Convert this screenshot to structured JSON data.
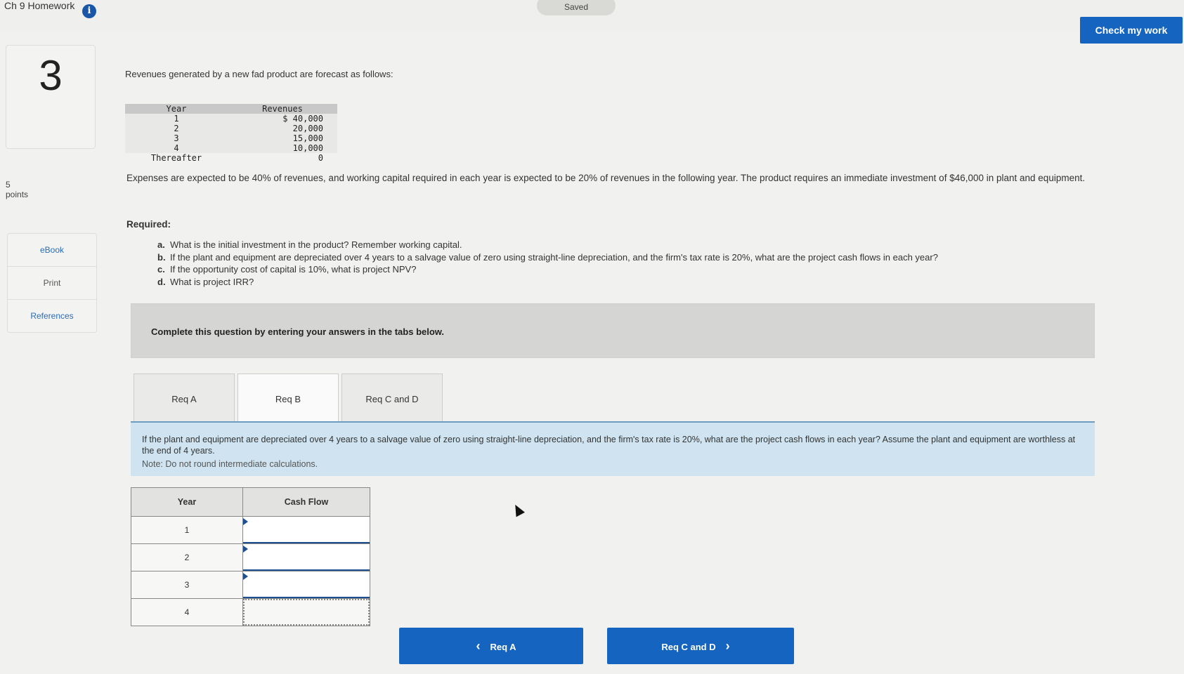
{
  "header": {
    "assignment_title": "Ch 9 Homework",
    "info_icon": "info-icon",
    "save_status": "Saved",
    "check_button": "Check my work"
  },
  "question": {
    "number": "3",
    "points_value": "5",
    "points_label": "points"
  },
  "side_links": [
    "eBook",
    "Print",
    "References"
  ],
  "problem": {
    "intro": "Revenues generated by a new fad product are forecast as follows:",
    "revenue_table": {
      "headers": [
        "Year",
        "Revenues"
      ],
      "rows": [
        [
          "1",
          "$ 40,000"
        ],
        [
          "2",
          "20,000"
        ],
        [
          "3",
          "15,000"
        ],
        [
          "4",
          "10,000"
        ],
        [
          "Thereafter",
          "0"
        ]
      ]
    },
    "expenses_text": "Expenses are expected to be 40% of revenues, and working capital required in each year is expected to be 20% of revenues in the following year. The product requires an immediate investment of $46,000 in plant and equipment.",
    "required_label": "Required:",
    "required_items": [
      {
        "letter": "a.",
        "text": "What is the initial investment in the product? Remember working capital."
      },
      {
        "letter": "b.",
        "text": "If the plant and equipment are depreciated over 4 years to a salvage value of zero using straight-line depreciation, and the firm's tax rate is 20%, what are the project cash flows in each year?"
      },
      {
        "letter": "c.",
        "text": "If the opportunity cost of capital is 10%, what is project NPV?"
      },
      {
        "letter": "d.",
        "text": "What is project IRR?"
      }
    ]
  },
  "answer_area": {
    "instruction": "Complete this question by entering your answers in the tabs below.",
    "tabs": [
      "Req A",
      "Req B",
      "Req C and D"
    ],
    "active_tab": "Req B",
    "question_text": "If the plant and equipment are depreciated over 4 years to a salvage value of zero using straight-line depreciation, and the firm's tax rate is 20%, what are the project cash flows in each year? Assume the plant and equipment are worthless at the end of 4 years.",
    "note": "Note: Do not round intermediate calculations.",
    "cash_flow_table": {
      "headers": [
        "Year",
        "Cash Flow"
      ],
      "rows": [
        {
          "year": "1",
          "value": ""
        },
        {
          "year": "2",
          "value": ""
        },
        {
          "year": "3",
          "value": ""
        },
        {
          "year": "4",
          "value": ""
        }
      ]
    }
  },
  "navigation": {
    "prev_label": "Req A",
    "next_label": "Req C and D",
    "prev_icon": "chevron-left-icon",
    "next_icon": "chevron-right-icon"
  }
}
